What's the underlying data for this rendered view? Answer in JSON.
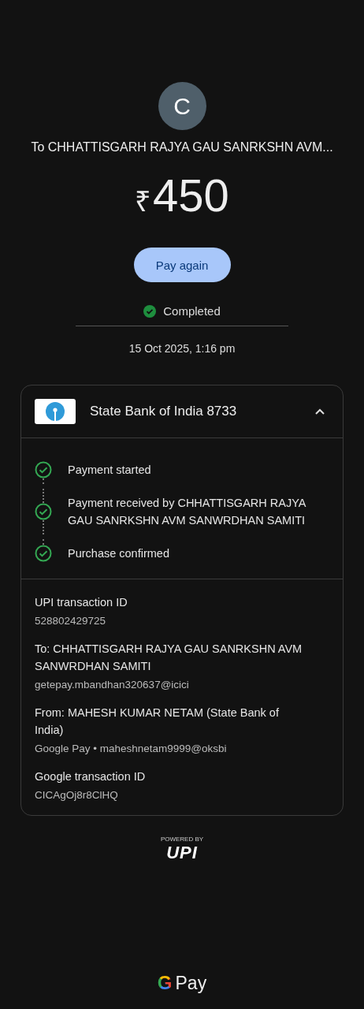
{
  "avatar": {
    "initial": "C"
  },
  "recipient": "To CHHATTISGARH RAJYA GAU SANRKSHN AVM...",
  "amount": {
    "currency": "₹",
    "value": "450"
  },
  "pay_again_button": "Pay again",
  "status": {
    "label": "Completed",
    "done": true
  },
  "date": "15 Oct 2025, 1:16 pm",
  "account": {
    "bank": "State Bank of India 8733",
    "expanded": true
  },
  "steps": [
    {
      "label": "Payment started",
      "done": true
    },
    {
      "label": "Payment received by CHHATTISGARH RAJYA GAU SANRKSHN AVM SANWRDHAN SAMITI",
      "done": true
    },
    {
      "label": "Purchase confirmed",
      "done": true
    }
  ],
  "details": [
    {
      "title": "UPI transaction ID",
      "value": "528802429725"
    },
    {
      "title": "To: CHHATTISGARH RAJYA GAU SANRKSHN AVM SANWRDHAN SAMITI",
      "value": "getepay.mbandhan320637@icici"
    },
    {
      "title": "From: MAHESH KUMAR  NETAM (State Bank of India)",
      "value": "Google Pay • maheshnetam9999@oksbi"
    },
    {
      "title": "Google transaction ID",
      "value": "CICAgOj8r8ClHQ"
    }
  ],
  "upi_badge": {
    "caption": "POWERED BY",
    "mark": "UPI"
  },
  "footer_logo": {
    "letter": "G",
    "word": "Pay"
  }
}
